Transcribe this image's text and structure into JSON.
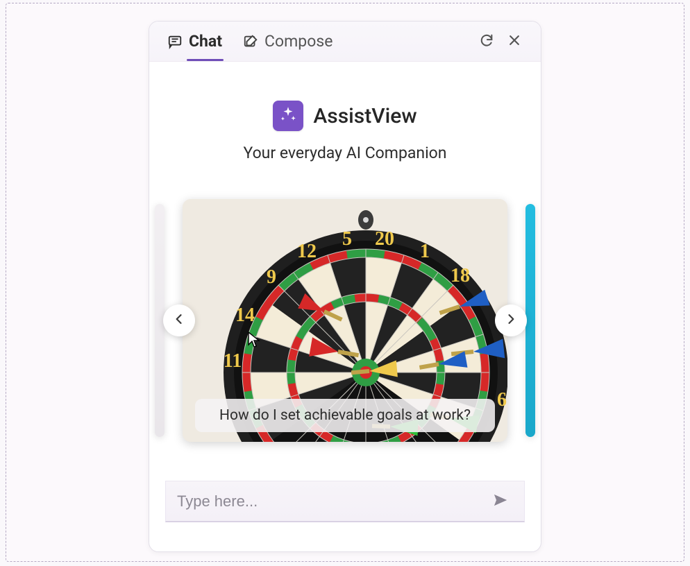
{
  "tabs": {
    "chat_label": "Chat",
    "compose_label": "Compose"
  },
  "icons": {
    "chat": "chat-bubble-icon",
    "compose": "compose-edit-icon",
    "refresh": "refresh-icon",
    "close": "close-icon",
    "brand": "sparkle-icon",
    "chevron_left": "chevron-left-icon",
    "chevron_right": "chevron-right-icon",
    "send": "send-icon"
  },
  "brand": {
    "name": "AssistView",
    "tagline": "Your everyday AI Companion"
  },
  "carousel": {
    "caption": "How do I set achievable goals at work?",
    "image_semantic": "dartboard-with-darts"
  },
  "input": {
    "placeholder": "Type here...",
    "value": ""
  }
}
